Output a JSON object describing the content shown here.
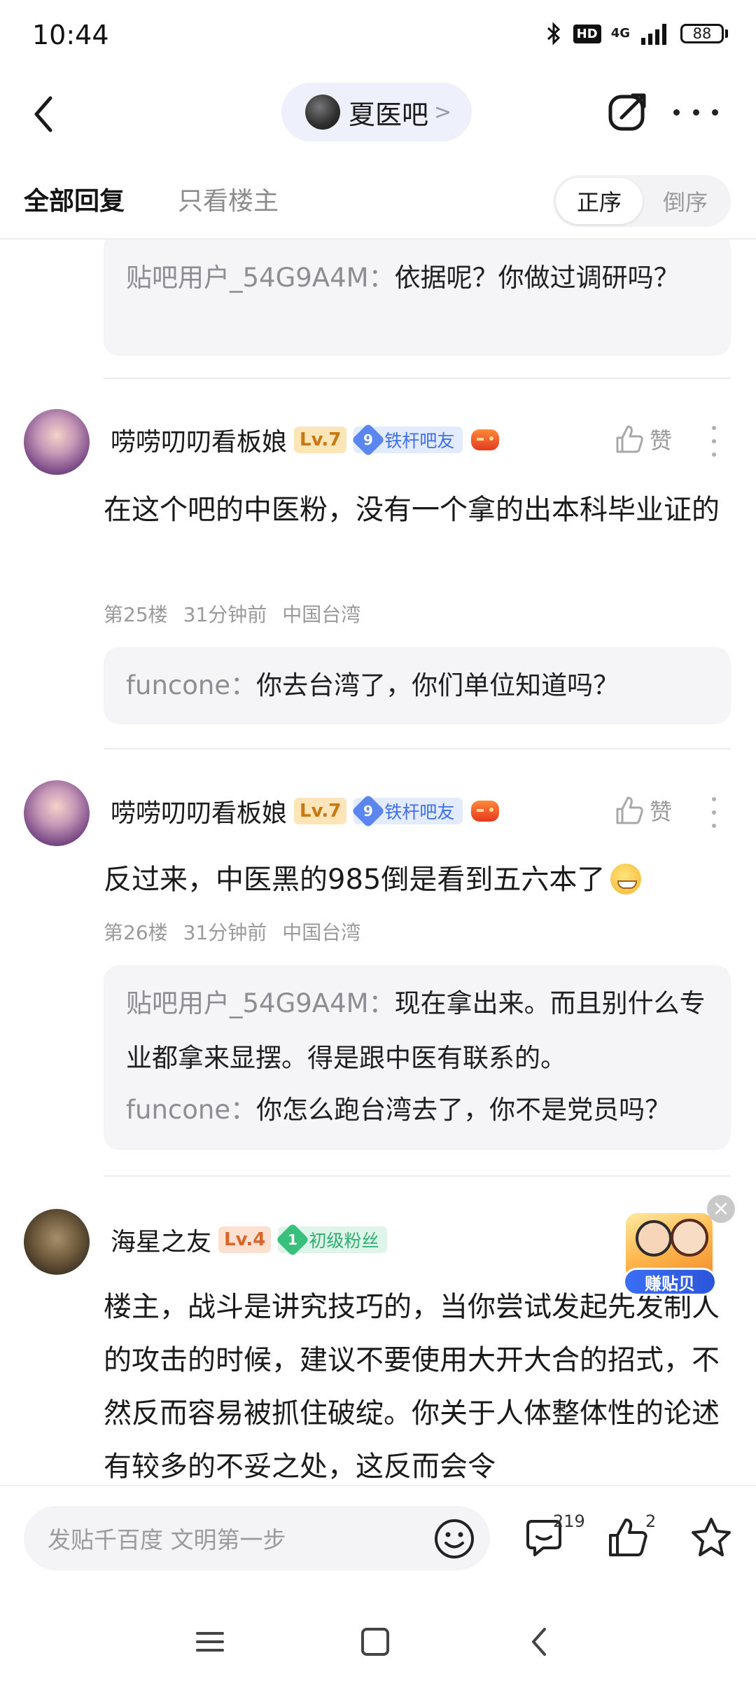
{
  "status": {
    "time": "10:44",
    "hd": "HD",
    "network": "4G",
    "battery": "88"
  },
  "header": {
    "forum_name": "夏医吧",
    "forum_arrow": ">"
  },
  "tabs": {
    "all": "全部回复",
    "owner_only": "只看楼主",
    "order_asc": "正序",
    "order_desc": "倒序"
  },
  "partial_reply": {
    "name": "贴吧用户_54G9A4M",
    "separator": "：",
    "text": "依据呢？你做过调研吗？"
  },
  "posts": [
    {
      "username": "唠唠叨叨看板娘",
      "level": "Lv.7",
      "fan_level": "9",
      "fan_title": "铁杆吧友",
      "like_label": "赞",
      "content": "在这个吧的中医粉，没有一个拿的出本科毕业证的",
      "floor": "第25楼",
      "time": "31分钟前",
      "location": "中国台湾",
      "replies": [
        {
          "name": "funcone",
          "separator": "：",
          "text": "你去台湾了，你们单位知道吗？"
        }
      ]
    },
    {
      "username": "唠唠叨叨看板娘",
      "level": "Lv.7",
      "fan_level": "9",
      "fan_title": "铁杆吧友",
      "like_label": "赞",
      "content": "反过来，中医黑的985倒是看到五六本了",
      "floor": "第26楼",
      "time": "31分钟前",
      "location": "中国台湾",
      "replies": [
        {
          "name": "贴吧用户_54G9A4M",
          "separator": "：",
          "text": "现在拿出来。而且别什么专业都拿来显摆。得是跟中医有联系的。"
        },
        {
          "name": "funcone",
          "separator": "：",
          "text": "你怎么跑台湾去了，你不是党员吗？"
        }
      ]
    },
    {
      "username": "海星之友",
      "level": "Lv.4",
      "fan_level": "1",
      "fan_title": "初级粉丝",
      "content": "楼主，战斗是讲究技巧的，当你尝试发起先发制人的攻击的时候，建议不要使用大开大合的招式，不然反而容易被抓住破绽。你关于人体整体性的论述有较多的不妥之处，这反而会令"
    }
  ],
  "promo": {
    "close": "×",
    "label": "赚贴贝"
  },
  "bottom_bar": {
    "input_placeholder": "发贴千百度 文明第一步",
    "comment_count": "219",
    "like_count": "2"
  },
  "colors": {
    "accent_blue": "#3e6fe8",
    "level_gold": "#c77812",
    "fan_green": "#2fae70",
    "pill_bg": "#eef0fb"
  }
}
